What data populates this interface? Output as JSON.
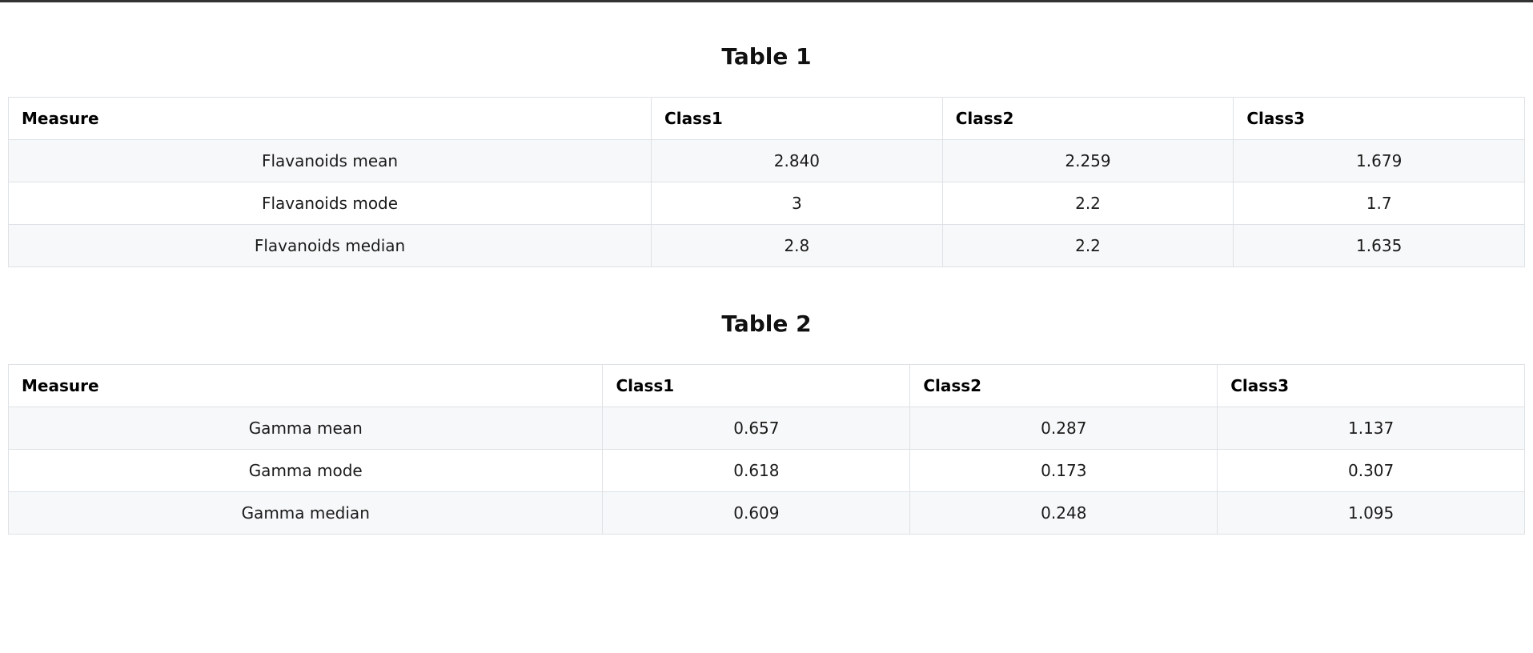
{
  "tables": [
    {
      "title": "Table 1",
      "headers": [
        "Measure",
        "Class1",
        "Class2",
        "Class3"
      ],
      "rows": [
        [
          "Flavanoids mean",
          "2.840",
          "2.259",
          "1.679"
        ],
        [
          "Flavanoids mode",
          "3",
          "2.2",
          "1.7"
        ],
        [
          "Flavanoids median",
          "2.8",
          "2.2",
          "1.635"
        ]
      ]
    },
    {
      "title": "Table 2",
      "headers": [
        "Measure",
        "Class1",
        "Class2",
        "Class3"
      ],
      "rows": [
        [
          "Gamma mean",
          "0.657",
          "0.287",
          "1.137"
        ],
        [
          "Gamma mode",
          "0.618",
          "0.173",
          "0.307"
        ],
        [
          "Gamma median",
          "0.609",
          "0.248",
          "1.095"
        ]
      ]
    }
  ],
  "colors": {
    "border": "#dee2e6",
    "stripe": "#f7f8f9",
    "top_bar": "#333333"
  }
}
